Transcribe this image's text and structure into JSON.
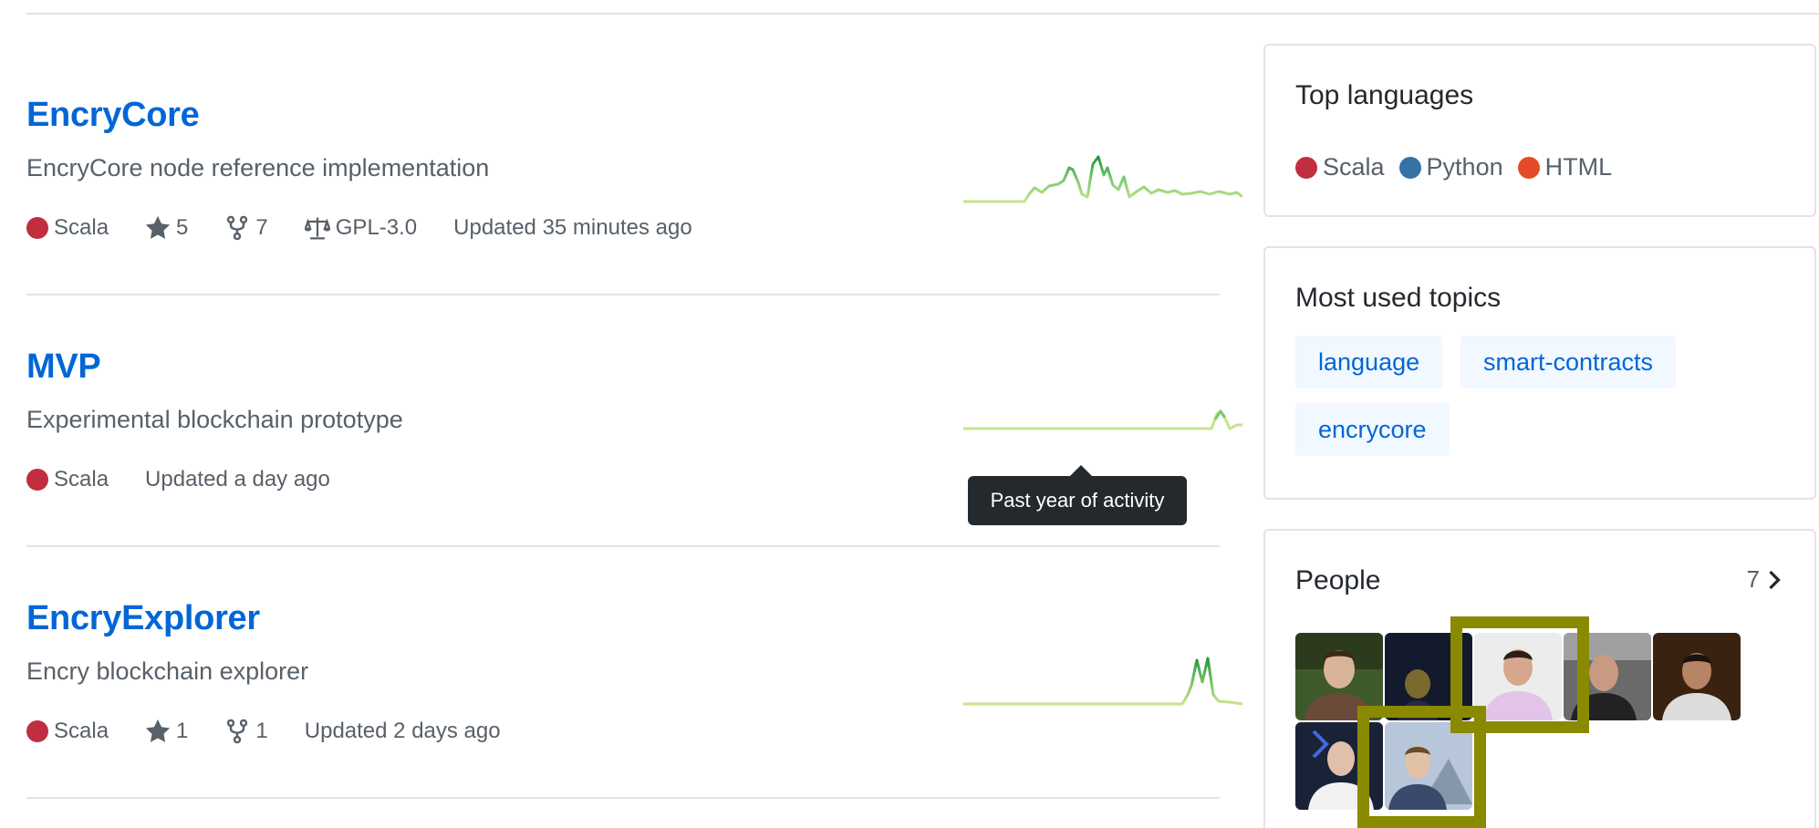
{
  "colors": {
    "link": "#0366d6",
    "scala": "#c22d40",
    "python": "#3572a5",
    "html": "#e34c26",
    "spark": "#8ecf80"
  },
  "repos": [
    {
      "name": "EncryCore",
      "description": "EncryCore node reference implementation",
      "language": "Scala",
      "stars": "5",
      "forks": "7",
      "license": "GPL-3.0",
      "updated": "Updated 35 minutes ago"
    },
    {
      "name": "MVP",
      "description": "Experimental blockchain prototype",
      "language": "Scala",
      "updated": "Updated a day ago"
    },
    {
      "name": "EncryExplorer",
      "description": "Encry blockchain explorer",
      "language": "Scala",
      "stars": "1",
      "forks": "1",
      "updated": "Updated 2 days ago"
    }
  ],
  "tooltip": "Past year of activity",
  "sidebar": {
    "top_languages": {
      "title": "Top languages",
      "items": [
        "Scala",
        "Python",
        "HTML"
      ]
    },
    "topics": {
      "title": "Most used topics",
      "items": [
        "language",
        "smart-contracts",
        "encrycore"
      ]
    },
    "people": {
      "title": "People",
      "count": "7"
    }
  }
}
